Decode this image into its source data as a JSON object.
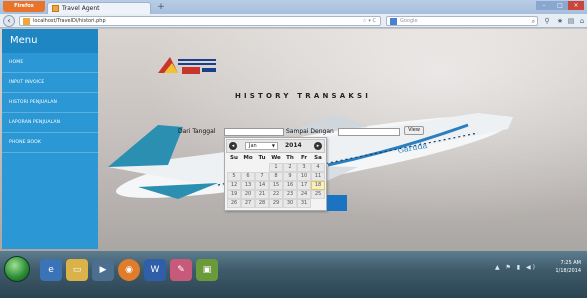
{
  "browser": {
    "menu_button": "Firefox",
    "tab_title": "Travel Agent",
    "new_tab": "+",
    "window_buttons": [
      "–",
      "□",
      "×"
    ],
    "url": "localhost/TravelDi/histori.php",
    "url_controls": "☆ ▾ C",
    "search_engine": "Google",
    "nav_icons": [
      "search",
      "star",
      "bookmarks",
      "home"
    ]
  },
  "sidebar": {
    "title": "Menu",
    "items": [
      {
        "label": "HOME"
      },
      {
        "label": "INPUT INVOICE"
      },
      {
        "label": "HISTORI PENJUALAN"
      },
      {
        "label": "LAPORAN PENJUALAN"
      },
      {
        "label": "PHONE BOOK"
      }
    ]
  },
  "main": {
    "title": "HISTORY TRANSAKSI",
    "from_label": "Dari Tanggal",
    "to_label": "Sampai Dengan",
    "view_button": "View"
  },
  "datepicker": {
    "month": "Jan",
    "year": "2014",
    "prev_icon": "prev-circle-icon",
    "next_icon": "next-circle-icon",
    "weekdays": [
      "Su",
      "Mo",
      "Tu",
      "We",
      "Th",
      "Fr",
      "Sa"
    ],
    "weeks": [
      [
        "",
        "",
        "",
        "1",
        "2",
        "3",
        "4"
      ],
      [
        "5",
        "6",
        "7",
        "8",
        "9",
        "10",
        "11"
      ],
      [
        "12",
        "13",
        "14",
        "15",
        "16",
        "17",
        "18"
      ],
      [
        "19",
        "20",
        "21",
        "22",
        "23",
        "24",
        "25"
      ],
      [
        "26",
        "27",
        "28",
        "29",
        "30",
        "31",
        ""
      ]
    ],
    "highlighted_day": "18"
  },
  "taskbar": {
    "pinned": [
      "ie",
      "folder",
      "media",
      "firefox",
      "word",
      "paint",
      "app"
    ],
    "time": "7:25 AM",
    "date": "1/18/2014"
  },
  "colors": {
    "sidebar": "#2c97d5",
    "sidebar_header": "#1f86c4",
    "accent_blue": "#1a74c2",
    "today_highlight": "#f8efc0"
  }
}
